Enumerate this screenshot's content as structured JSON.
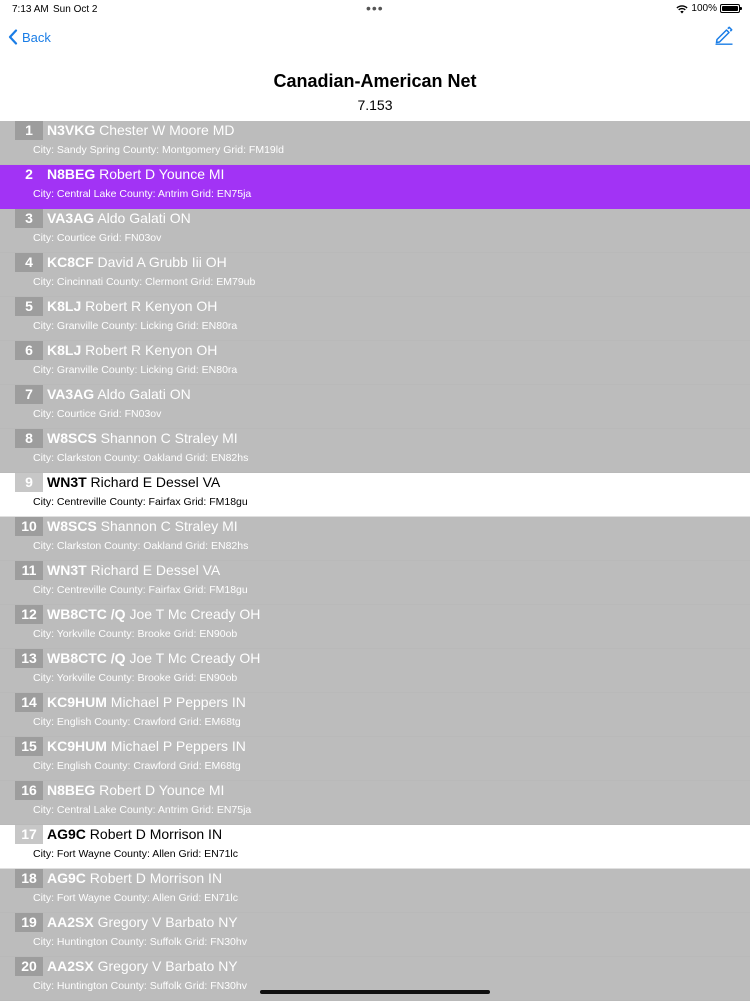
{
  "status": {
    "time": "7:13 AM",
    "date": "Sun Oct 2",
    "battery": "100%"
  },
  "nav": {
    "back_label": "Back"
  },
  "header": {
    "title": "Canadian-American Net",
    "frequency": "7.153"
  },
  "colors": {
    "accent": "#1a7de6",
    "active_row": "#a233f5",
    "dimmed_row": "#bcbcbc"
  },
  "rows": [
    {
      "num": "1",
      "call": "N3VKG",
      "name": " Chester W Moore MD",
      "details": "City: Sandy Spring County: Montgomery Grid: FM19ld",
      "state": "dimmed"
    },
    {
      "num": "2",
      "call": "N8BEG",
      "name": " Robert D Younce MI",
      "details": "City: Central Lake County: Antrim Grid: EN75ja",
      "state": "active"
    },
    {
      "num": "3",
      "call": "VA3AG",
      "name": " Aldo Galati ON",
      "details": "City: Courtice  Grid: FN03ov",
      "state": "dimmed"
    },
    {
      "num": "4",
      "call": "KC8CF",
      "name": " David A Grubb Iii OH",
      "details": "City: Cincinnati County: Clermont Grid: EM79ub",
      "state": "dimmed"
    },
    {
      "num": "5",
      "call": "K8LJ",
      "name": " Robert R Kenyon OH",
      "details": "City: Granville County: Licking Grid: EN80ra",
      "state": "dimmed"
    },
    {
      "num": "6",
      "call": "K8LJ",
      "name": " Robert R Kenyon OH",
      "details": "City: Granville County: Licking Grid: EN80ra",
      "state": "dimmed"
    },
    {
      "num": "7",
      "call": "VA3AG",
      "name": " Aldo Galati ON",
      "details": "City: Courtice  Grid: FN03ov",
      "state": "dimmed"
    },
    {
      "num": "8",
      "call": "W8SCS",
      "name": " Shannon C Straley MI",
      "details": "City: Clarkston County: Oakland Grid: EN82hs",
      "state": "dimmed"
    },
    {
      "num": "9",
      "call": "WN3T",
      "name": " Richard E Dessel VA",
      "details": "City: Centreville County: Fairfax Grid: FM18gu",
      "state": "normal"
    },
    {
      "num": "10",
      "call": "W8SCS",
      "name": " Shannon C Straley MI",
      "details": "City: Clarkston County: Oakland Grid: EN82hs",
      "state": "dimmed"
    },
    {
      "num": "11",
      "call": "WN3T",
      "name": " Richard E Dessel VA",
      "details": "City: Centreville County: Fairfax Grid: FM18gu",
      "state": "dimmed"
    },
    {
      "num": "12",
      "call": "WB8CTC /Q",
      "name": " Joe T Mc Cready OH",
      "details": "City: Yorkville County: Brooke Grid: EN90ob",
      "state": "dimmed"
    },
    {
      "num": "13",
      "call": "WB8CTC /Q",
      "name": " Joe T Mc Cready OH",
      "details": "City: Yorkville County: Brooke Grid: EN90ob",
      "state": "dimmed"
    },
    {
      "num": "14",
      "call": "KC9HUM",
      "name": " Michael P Peppers IN",
      "details": "City: English County: Crawford Grid: EM68tg",
      "state": "dimmed"
    },
    {
      "num": "15",
      "call": "KC9HUM",
      "name": " Michael P Peppers IN",
      "details": "City: English County: Crawford Grid: EM68tg",
      "state": "dimmed"
    },
    {
      "num": "16",
      "call": "N8BEG",
      "name": " Robert D Younce MI",
      "details": "City: Central Lake County: Antrim Grid: EN75ja",
      "state": "dimmed"
    },
    {
      "num": "17",
      "call": "AG9C",
      "name": " Robert D Morrison IN",
      "details": "City: Fort Wayne County: Allen Grid: EN71lc",
      "state": "normal"
    },
    {
      "num": "18",
      "call": "AG9C",
      "name": " Robert D Morrison IN",
      "details": "City: Fort Wayne County: Allen Grid: EN71lc",
      "state": "dimmed"
    },
    {
      "num": "19",
      "call": "AA2SX",
      "name": " Gregory V Barbato NY",
      "details": "City: Huntington County: Suffolk Grid: FN30hv",
      "state": "dimmed"
    },
    {
      "num": "20",
      "call": "AA2SX",
      "name": " Gregory V Barbato NY",
      "details": "City: Huntington County: Suffolk Grid: FN30hv",
      "state": "dimmed"
    }
  ]
}
